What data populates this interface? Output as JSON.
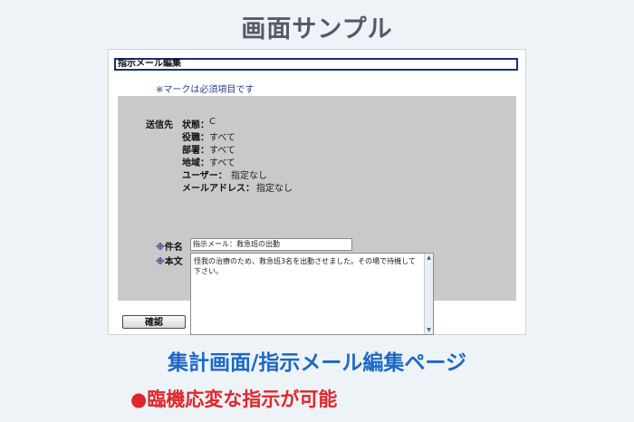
{
  "heading": "画面サンプル",
  "window": {
    "title": "指示メール編集",
    "required_note": "※マークは必須項目です"
  },
  "recipient": {
    "label": "送信先",
    "status_label": "状態：",
    "status_value": "C",
    "role_label": "役職：",
    "role_value": "すべて",
    "dept_label": "部署：",
    "dept_value": "すべて",
    "region_label": "地域：",
    "region_value": "すべて",
    "user_label": "ユーザー：",
    "user_value": "指定なし",
    "mail_label": "メールアドレス：",
    "mail_value": "指定なし"
  },
  "subject": {
    "mark": "※",
    "label": "件名",
    "value": "指示メール：救急班の出動"
  },
  "body": {
    "mark": "※",
    "label": "本文",
    "value": "怪我の治療のため、救急班3名を出動させました。その場で待機して下さい。"
  },
  "confirm_button": "確認",
  "caption_main": "集計画面/指示メール編集ページ",
  "caption_sub": "●臨機応変な指示が可能",
  "colors": {
    "accent_blue": "#1c68c8",
    "accent_red": "#e0262a",
    "title_border": "#15307a"
  }
}
